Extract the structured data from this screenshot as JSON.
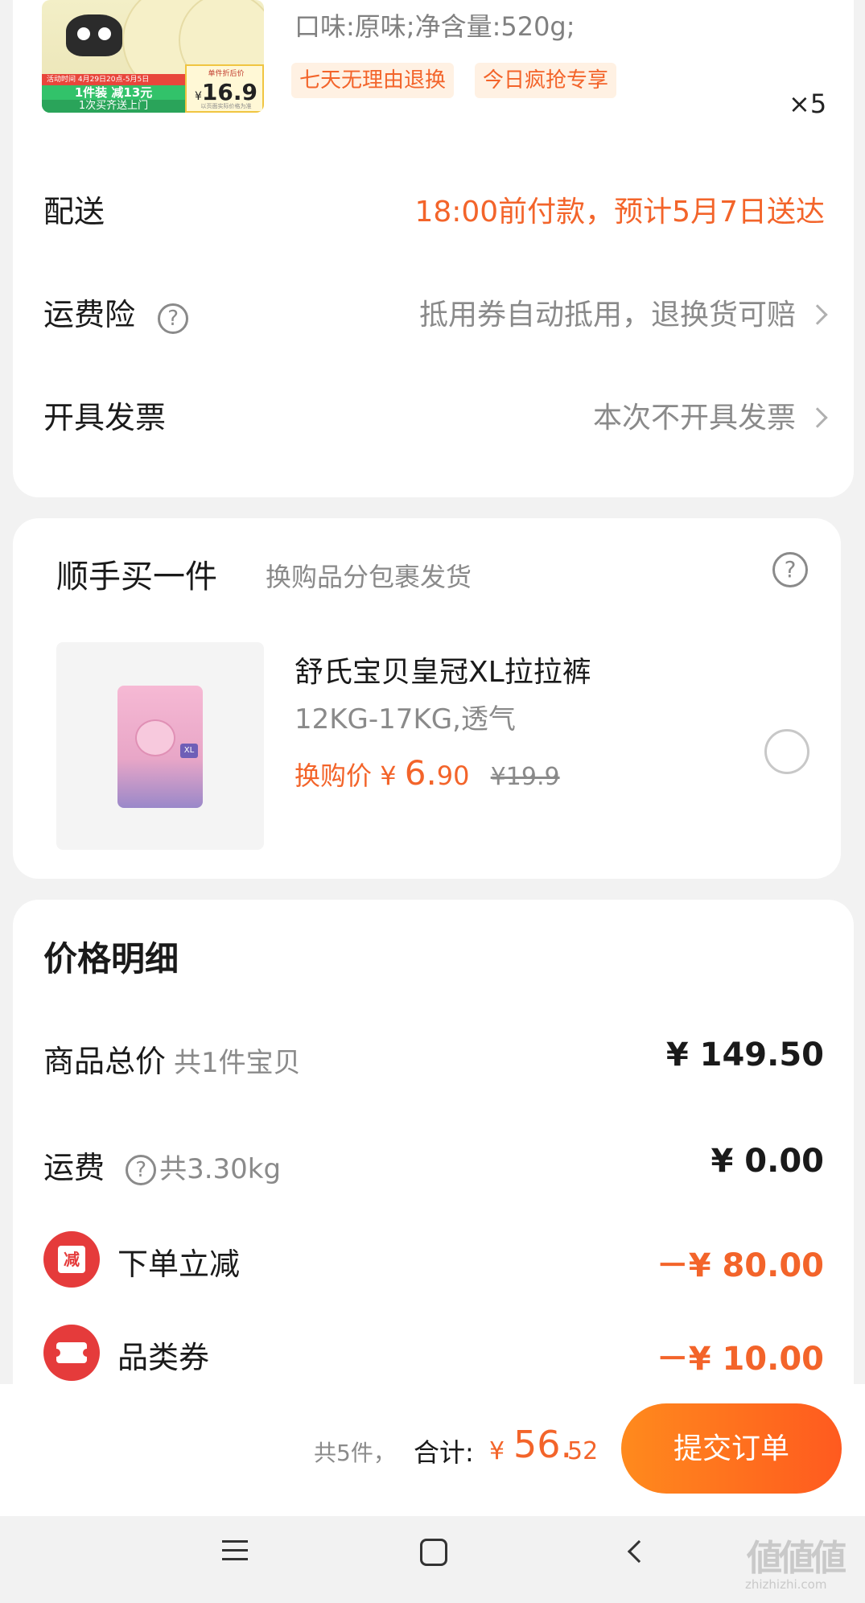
{
  "product": {
    "promo_line1": "活动时间 4月29日20点-5月5日",
    "promo_line2": "1件装 减13元",
    "promo_line3": "1次买齐送上门",
    "price_tag_title": "单件折后价",
    "price_tag_value": "16.9",
    "price_tag_symbol": "¥",
    "price_tag_note": "以页面实际价格为准",
    "spec": "口味:原味;净含量:520g;",
    "tags": [
      "七天无理由退换",
      "今日疯抢专享"
    ],
    "quantity": "×5"
  },
  "delivery": {
    "label": "配送",
    "value": "18:00前付款，预计5月7日送达"
  },
  "freight_insurance": {
    "label": "运费险",
    "value": "抵用券自动抵用，退换货可赔"
  },
  "invoice": {
    "label": "开具发票",
    "value": "本次不开具发票"
  },
  "addon": {
    "title": "顺手买一件",
    "subtitle": "换购品分包裹发货",
    "item_name": "舒氏宝贝皇冠XL拉拉裤",
    "item_spec": "12KG-17KG,透气",
    "price_label": "换购价",
    "price_symbol": "¥",
    "price_int": "6.",
    "price_dec": "90",
    "original_price": "¥19.9",
    "selected": false
  },
  "price_detail": {
    "title": "价格明细",
    "rows": [
      {
        "label": "商品总价",
        "sub": "共1件宝贝",
        "value": "¥ 149.50"
      },
      {
        "label": "运费",
        "sub": "共3.30kg",
        "value": "¥ 0.00"
      },
      {
        "label": "下单立减",
        "icon_text": "减",
        "value": "－¥ 80.00"
      },
      {
        "label": "品类券",
        "value": "－¥ 10.00"
      }
    ]
  },
  "bottom_bar": {
    "count": "共5件，",
    "total_label": "合计:",
    "total_symbol": "¥",
    "total_int": "56.",
    "total_dec": "52",
    "submit_label": "提交订单"
  },
  "watermark": {
    "main": "値値値",
    "sub": "zhizhizhi.com"
  },
  "colors": {
    "accent": "#f3642a",
    "button_start": "#ff8a1d",
    "button_end": "#ff5a1f",
    "discount_icon": "#e53b3b"
  }
}
